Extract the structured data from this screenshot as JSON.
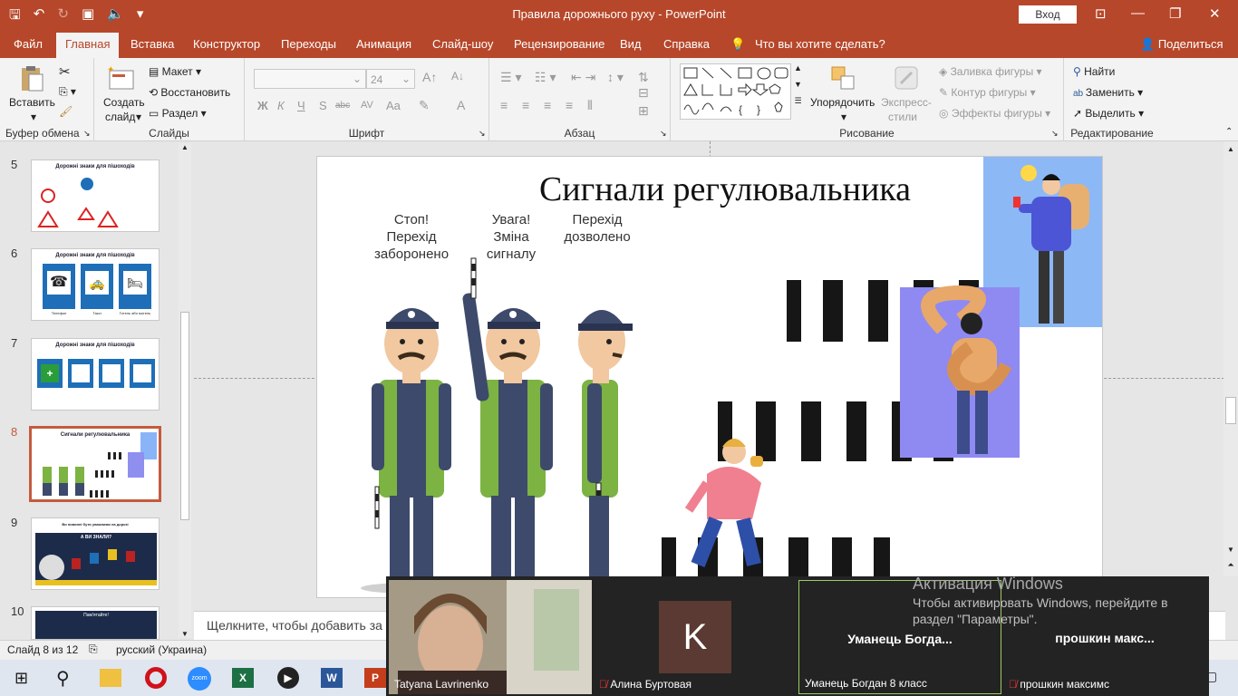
{
  "window": {
    "title": "Правила дорожнього руху  -  PowerPoint",
    "signin": "Вход"
  },
  "tabs": [
    "Файл",
    "Главная",
    "Вставка",
    "Конструктор",
    "Переходы",
    "Анимация",
    "Слайд-шоу",
    "Рецензирование",
    "Вид",
    "Справка"
  ],
  "active_tab": "Главная",
  "tell_me": "Что вы хотите сделать?",
  "share": "Поделиться",
  "ribbon": {
    "clipboard": {
      "label": "Буфер обмена",
      "paste": "Вставить"
    },
    "slides": {
      "label": "Слайды",
      "new_slide_1": "Создать",
      "new_slide_2": "слайд",
      "layout": "Макет",
      "reset": "Восстановить",
      "section": "Раздел"
    },
    "font": {
      "label": "Шрифт",
      "size": "24",
      "bold": "Ж",
      "italic": "К",
      "underline": "Ч",
      "shadow": "S",
      "strike": "abc",
      "spacing": "AV",
      "case": "Aa",
      "color": "A"
    },
    "paragraph": {
      "label": "Абзац"
    },
    "drawing": {
      "label": "Рисование",
      "arrange": "Упорядочить",
      "quick_styles_1": "Экспресс-",
      "quick_styles_2": "стили",
      "fill": "Заливка фигуры",
      "outline": "Контур фигуры",
      "effects": "Эффекты фигуры"
    },
    "editing": {
      "label": "Редактирование",
      "find": "Найти",
      "replace": "Заменить",
      "select": "Выделить"
    }
  },
  "thumbnails": [
    {
      "num": "5",
      "title": "Дорожні знаки для пішоходів"
    },
    {
      "num": "6",
      "title": "Дорожні знаки для пішоходів",
      "captions": [
        "Телефон",
        "Таксі",
        "Готель або мотель"
      ]
    },
    {
      "num": "7",
      "title": "Дорожні знаки для пішоходів"
    },
    {
      "num": "8",
      "title": "Сигнали регулювальника"
    },
    {
      "num": "9",
      "title": "Ви повинні бути уважними на дорозі",
      "inner": "А ВИ ЗНАЛИ?"
    },
    {
      "num": "10",
      "title": "Пам'ятайте!"
    }
  ],
  "slide": {
    "title": "Сигнали регулювальника",
    "signals": [
      "Стоп!\nПерехід\nзаборонено",
      "Увага!\nЗміна\nсигналу",
      "Перехід\nдозволено"
    ]
  },
  "notes_placeholder": "Щелкните, чтобы добавить за",
  "status": {
    "slide": "Слайд 8 из 12",
    "language": "русский (Украина)"
  },
  "zoom": {
    "p1": "Tatyana Lavrinenko",
    "p2": "Алина Буртовая",
    "p2_initial": "K",
    "p3_center": "Уманець  Богда...",
    "p3": "Уманець Богдан 8 класс",
    "p4_center": "прошкин  макс...",
    "p4": "прошкин максимс"
  },
  "activation": {
    "title": "Активация Windows",
    "line1": "Чтобы активировать Windows, перейдите в",
    "line2": "раздел \"Параметры\"."
  },
  "colors": {
    "accent": "#b7472a",
    "selection": "#c55a3d",
    "zoom_bg": "#232323",
    "avatar": "#5a3a32",
    "active_speaker": "#9ccc65"
  }
}
